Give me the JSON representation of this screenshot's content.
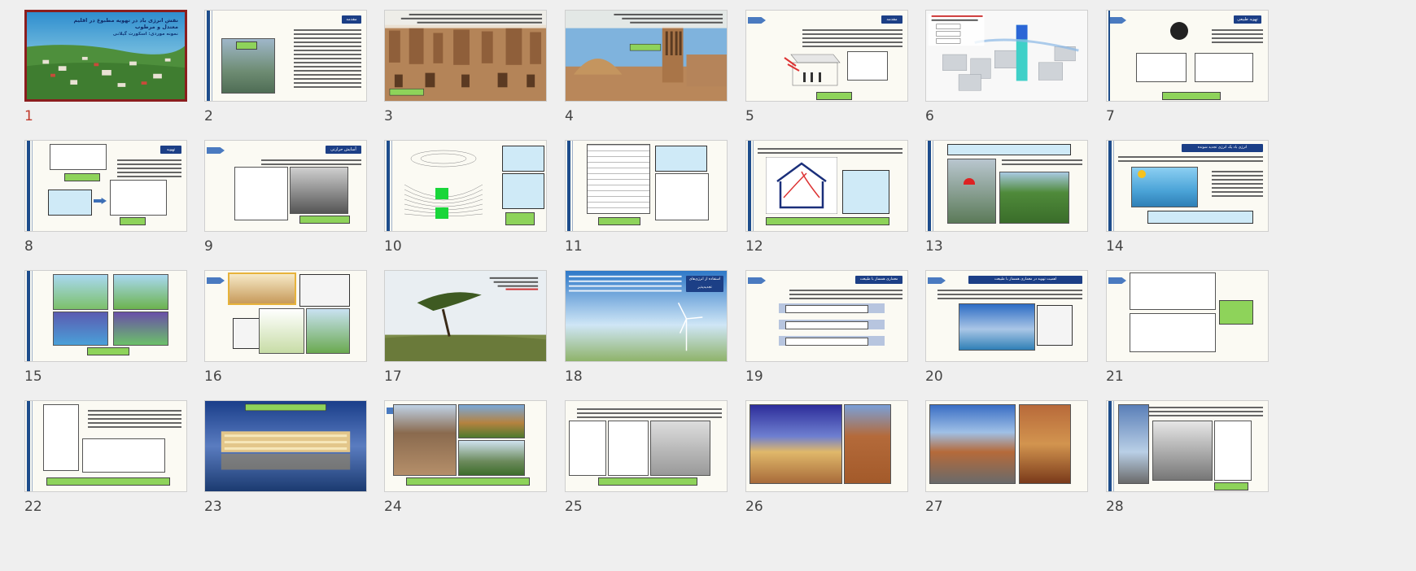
{
  "view": "slide-sorter",
  "selected_slide": "1",
  "slides": [
    {
      "number": "1",
      "title_line1": "نقش انرژی باد در تهویه مطبوع در اقلیم معتدل و مرطوب",
      "title_line2": "نمونه موردی: اسکورت گیلانی"
    },
    {
      "number": "2",
      "heading": "مقدمه"
    },
    {
      "number": "3"
    },
    {
      "number": "4"
    },
    {
      "number": "5",
      "heading": "مقدمه"
    },
    {
      "number": "6"
    },
    {
      "number": "7",
      "heading": "تهویه طبیعی"
    },
    {
      "number": "8",
      "heading": "تهویه"
    },
    {
      "number": "9",
      "heading": "آسایش حرارتی"
    },
    {
      "number": "10"
    },
    {
      "number": "11"
    },
    {
      "number": "12"
    },
    {
      "number": "13"
    },
    {
      "number": "14",
      "heading": "انرژی باد یک انرژی تجدید شونده"
    },
    {
      "number": "15"
    },
    {
      "number": "16"
    },
    {
      "number": "17"
    },
    {
      "number": "18",
      "heading": "استفاده از انرژی‌های تجدیدپذیر"
    },
    {
      "number": "19",
      "heading": "معماری همساز با طبیعت"
    },
    {
      "number": "20",
      "heading": "اهمیت تهویه در معماری همساز با طبیعت"
    },
    {
      "number": "21"
    },
    {
      "number": "22"
    },
    {
      "number": "23"
    },
    {
      "number": "24"
    },
    {
      "number": "25"
    },
    {
      "number": "26"
    },
    {
      "number": "27"
    },
    {
      "number": "28"
    }
  ],
  "colors": {
    "selected_border": "#8b1e1e",
    "selected_number": "#c0392b",
    "accent_bar": "#1e4d8c",
    "title_fill": "#1c3f86",
    "caption_green": "#8ed35a",
    "text_box_cyan": "#cfeaf7"
  }
}
